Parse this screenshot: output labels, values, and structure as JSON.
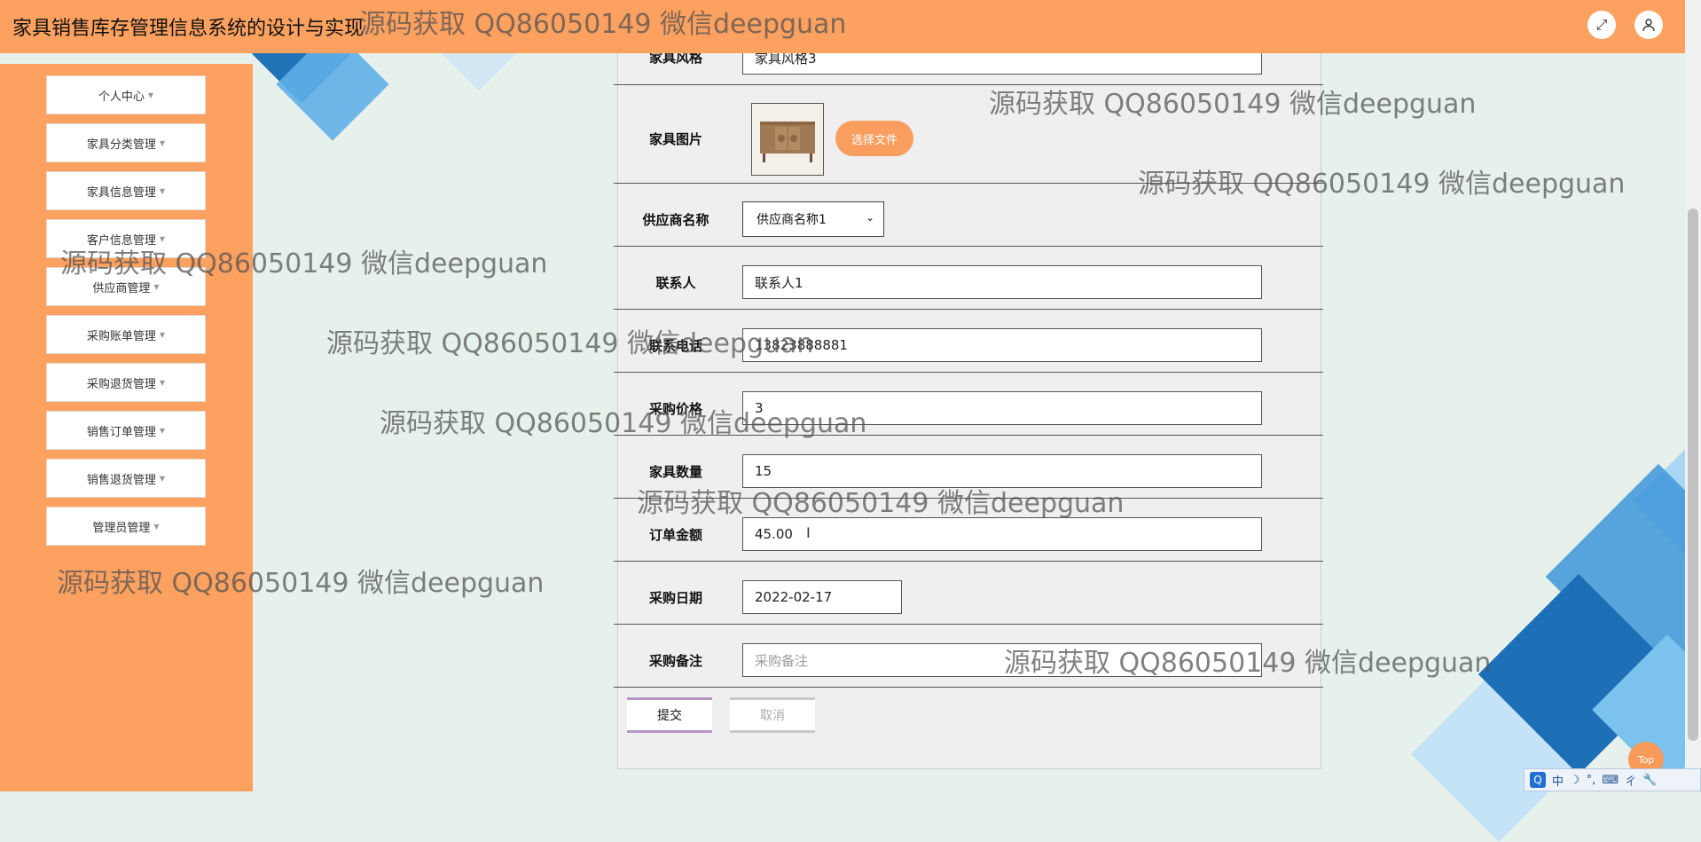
{
  "header": {
    "app_title": "家具销售库存管理信息系统的设计与实现",
    "icons": [
      "fullscreen-icon",
      "user-icon"
    ]
  },
  "sidebar": {
    "items": [
      {
        "label": "个人中心"
      },
      {
        "label": "家具分类管理"
      },
      {
        "label": "家具信息管理"
      },
      {
        "label": "客户信息管理"
      },
      {
        "label": "供应商管理"
      },
      {
        "label": "采购账单管理"
      },
      {
        "label": "采购退货管理"
      },
      {
        "label": "销售订单管理"
      },
      {
        "label": "销售退货管理"
      },
      {
        "label": "管理员管理"
      }
    ]
  },
  "form": {
    "style": {
      "label": "家具风格",
      "value": "家具风格3"
    },
    "image": {
      "label": "家具图片",
      "button_label": "选择文件"
    },
    "supplier": {
      "label": "供应商名称",
      "value": "供应商名称1"
    },
    "contact": {
      "label": "联系人",
      "value": "联系人1"
    },
    "phone": {
      "label": "联系电话",
      "value": "13823888881"
    },
    "price": {
      "label": "采购价格",
      "value": "3"
    },
    "quantity": {
      "label": "家具数量",
      "value": "15"
    },
    "amount": {
      "label": "订单金额",
      "value": "45.00"
    },
    "date": {
      "label": "采购日期",
      "value": "2022-02-17"
    },
    "notes": {
      "label": "采购备注",
      "placeholder": "采购备注"
    },
    "submit_label": "提交",
    "cancel_label": "取消"
  },
  "top_button": "Top",
  "ime": {
    "logo": "Q",
    "mode": "中",
    "moon": "☽",
    "punct": "°,",
    "kbd": "⌨",
    "lang": "ㄔ",
    "tool": "🔧"
  },
  "watermark": "源码获取 QQ86050149 微信deepguan"
}
